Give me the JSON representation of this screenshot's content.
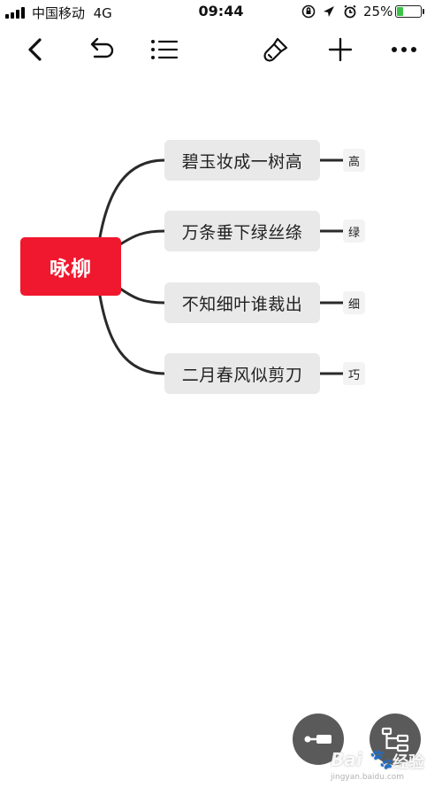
{
  "status_bar": {
    "carrier": "中国移动",
    "network": "4G",
    "time": "09:44",
    "battery_percent": "25%",
    "battery_level": 0.25,
    "battery_color": "#3cc44a"
  },
  "toolbar": {
    "icons": [
      "back-icon",
      "undo-icon",
      "outline-list-icon",
      "style-brush-icon",
      "add-icon",
      "more-icon"
    ]
  },
  "mindmap": {
    "root": {
      "label": "咏柳",
      "color": "#f0182e"
    },
    "branches": [
      {
        "label": "碧玉妆成一树高",
        "leaf": "高"
      },
      {
        "label": "万条垂下绿丝绦",
        "leaf": "绿"
      },
      {
        "label": "不知细叶谁裁出",
        "leaf": "细"
      },
      {
        "label": "二月春风似剪刀",
        "leaf": "巧"
      }
    ]
  },
  "fabs": {
    "icons": [
      "insert-node-icon",
      "layout-tree-icon"
    ]
  },
  "watermark": {
    "logo": "Bai",
    "text": "经验",
    "url": "jingyan.baidu.com"
  }
}
